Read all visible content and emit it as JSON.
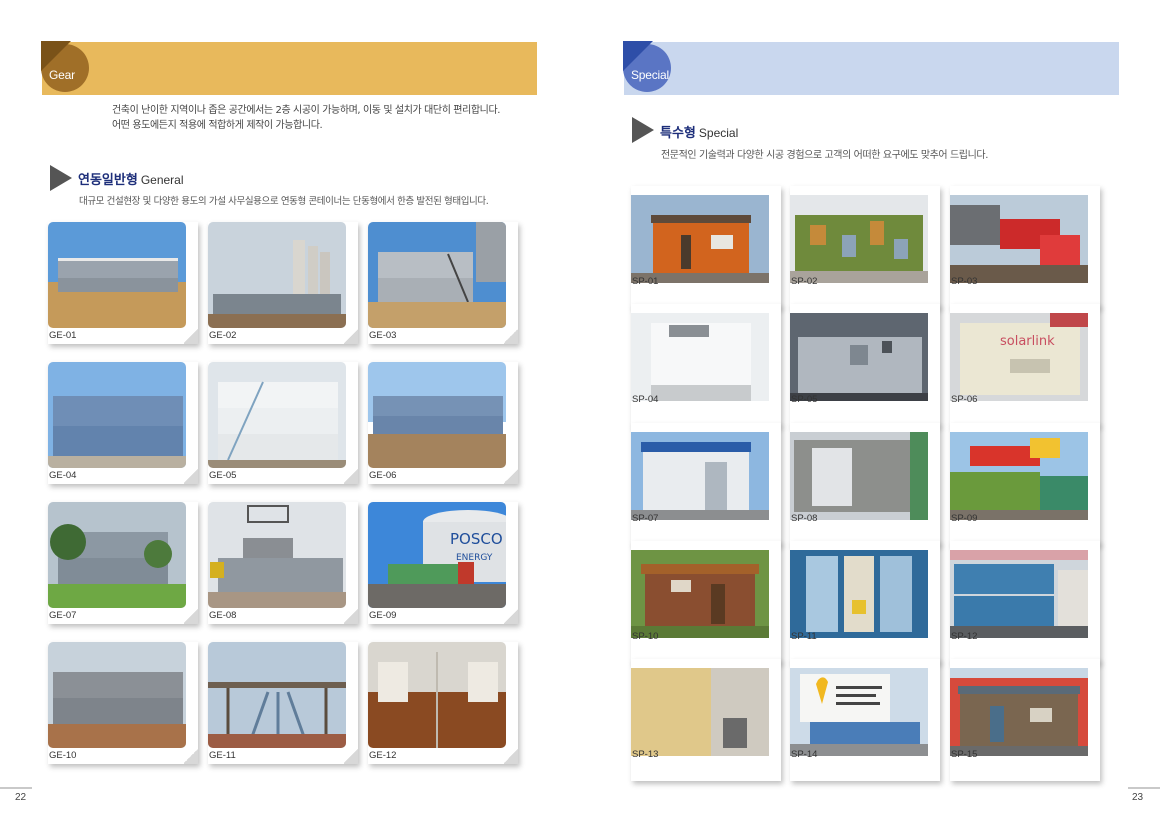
{
  "left_page": {
    "header_label": "Gear",
    "intro_lines": [
      "건축이 난이한 지역이나 좁은 공간에서는 2층 시공이 가능하며, 이동 및 설치가 대단히 편리합니다.",
      "어떤 용도에든지 적용에 적합하게 제작이 가능합니다."
    ],
    "section_title_ko": "연동일반형",
    "section_title_en": "General",
    "section_desc": "대규모 건설현장 및 다양한 용도의 가설 사무실용으로 연동형 콘테이너는 단동형에서 한층 발전된 형태입니다.",
    "cards": [
      "GE-01",
      "GE-02",
      "GE-03",
      "GE-04",
      "GE-05",
      "GE-06",
      "GE-07",
      "GE-08",
      "GE-09",
      "GE-10",
      "GE-11",
      "GE-12"
    ],
    "page_number": "22"
  },
  "right_page": {
    "header_label": "Special",
    "section_title_ko": "특수형",
    "section_title_en": "Special",
    "section_desc": "전문적인 기술력과 다양한 시공 경험으로 고객의 어떠한 요구에도 맞추어 드립니다.",
    "cards": [
      "SP-01",
      "SP-02",
      "SP-03",
      "SP-04",
      "SP-05",
      "SP-06",
      "SP-07",
      "SP-08",
      "SP-09",
      "SP-10",
      "SP-11",
      "SP-12",
      "SP-13",
      "SP-14",
      "SP-15"
    ],
    "photo_texts": {
      "sp06": "solarlink",
      "ge09_line1": "POSCO",
      "ge09_line2": "ENERGY"
    },
    "page_number": "23"
  },
  "colors": {
    "gear_bar": "#e8b95c",
    "special_bar": "#c9d7ee",
    "section_title": "#1d2e7a"
  }
}
